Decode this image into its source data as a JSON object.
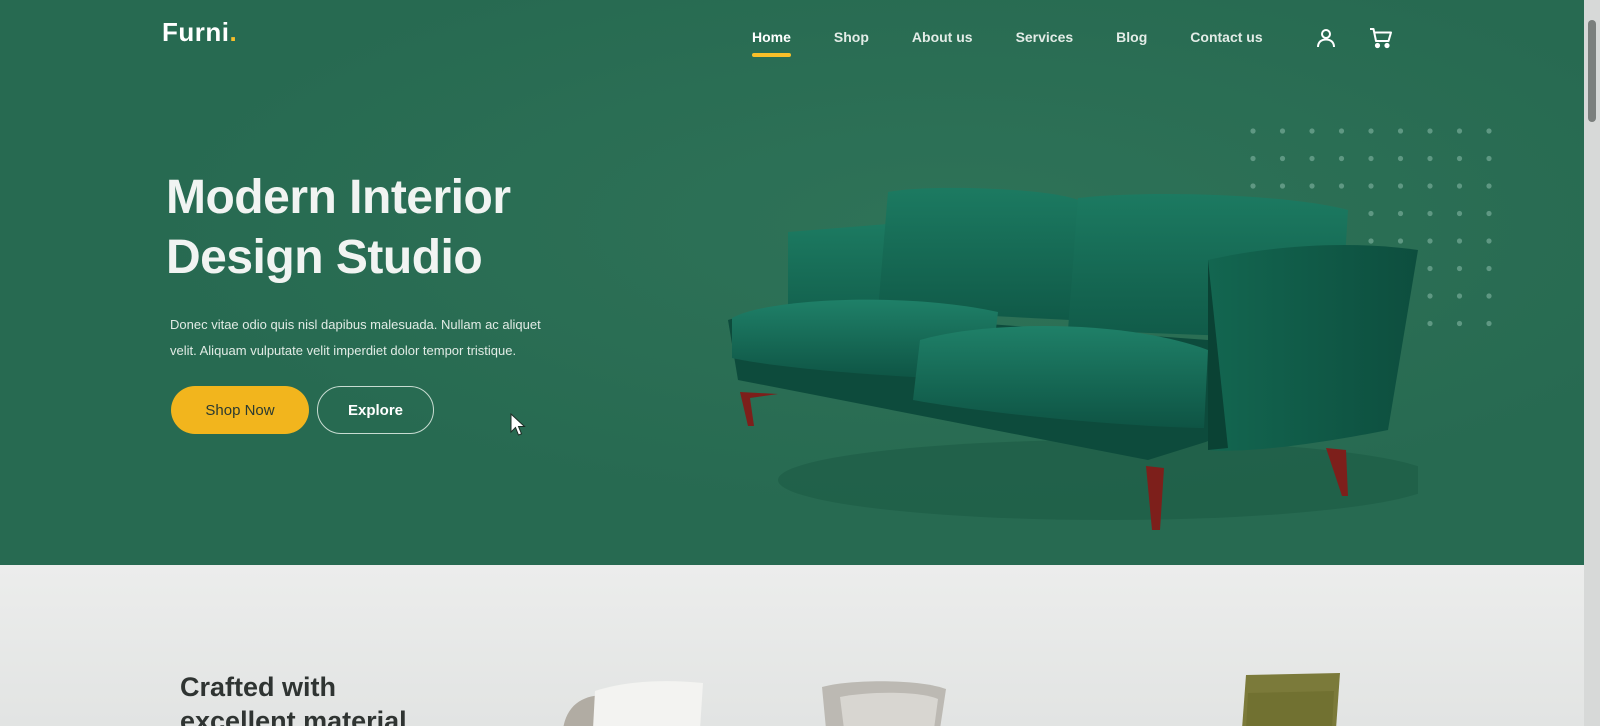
{
  "brand": {
    "name": "Furni",
    "dot": "."
  },
  "nav": {
    "items": [
      {
        "label": "Home",
        "active": true
      },
      {
        "label": "Shop",
        "active": false
      },
      {
        "label": "About us",
        "active": false
      },
      {
        "label": "Services",
        "active": false
      },
      {
        "label": "Blog",
        "active": false
      },
      {
        "label": "Contact us",
        "active": false
      }
    ],
    "icons": [
      "user-icon",
      "cart-icon"
    ]
  },
  "hero": {
    "title_line1": "Modern Interior",
    "title_line2": "Design Studio",
    "description_line1": "Donec vitae odio quis nisl dapibus malesuada. Nullam ac aliquet",
    "description_line2": "velit. Aliquam vulputate velit imperdiet dolor tempor tristique.",
    "primary_button": "Shop Now",
    "secondary_button": "Explore",
    "image": "sofa-image"
  },
  "section2": {
    "heading_line1": "Crafted with",
    "heading_line2": "excellent material."
  },
  "colors": {
    "hero_bg": "#276a51",
    "accent": "#f9bf29",
    "button_yellow": "#f2b51d",
    "text_light": "#ffffff"
  }
}
